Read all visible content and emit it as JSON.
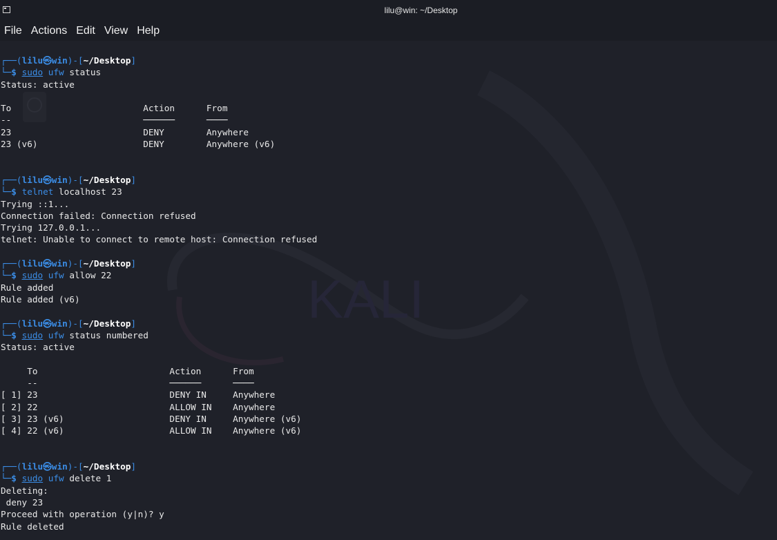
{
  "window": {
    "title": "lilu@win: ~/Desktop"
  },
  "menu": [
    "File",
    "Actions",
    "Edit",
    "View",
    "Help"
  ],
  "prompt": {
    "user": "lilu",
    "at": "㉿",
    "host": "win",
    "dir": "~/Desktop"
  },
  "blocks": [
    {
      "cmd": [
        "sudo",
        "ufw",
        " status"
      ],
      "output": [
        "Status: active",
        "",
        "To                         Action      From",
        "--                         ──────      ────",
        "23                         DENY        Anywhere",
        "23 (v6)                    DENY        Anywhere (v6)",
        "",
        ""
      ]
    },
    {
      "cmd": [
        "",
        "telnet",
        " localhost 23"
      ],
      "output": [
        "Trying ::1...",
        "Connection failed: Connection refused",
        "Trying 127.0.0.1...",
        "telnet: Unable to connect to remote host: Connection refused",
        ""
      ]
    },
    {
      "cmd": [
        "sudo",
        "ufw",
        " allow 22"
      ],
      "output": [
        "Rule added",
        "Rule added (v6)",
        ""
      ]
    },
    {
      "cmd": [
        "sudo",
        "ufw",
        " status numbered"
      ],
      "output": [
        "Status: active",
        "",
        "     To                         Action      From",
        "     --                         ──────      ────",
        "[ 1] 23                         DENY IN     Anywhere",
        "[ 2] 22                         ALLOW IN    Anywhere",
        "[ 3] 23 (v6)                    DENY IN     Anywhere (v6)",
        "[ 4] 22 (v6)                    ALLOW IN    Anywhere (v6)",
        "",
        ""
      ]
    },
    {
      "cmd": [
        "sudo",
        "ufw",
        " delete 1"
      ],
      "output": [
        "Deleting:",
        " deny 23",
        "Proceed with operation (y|n)? y",
        "Rule deleted"
      ]
    }
  ],
  "watermark": "KALI"
}
